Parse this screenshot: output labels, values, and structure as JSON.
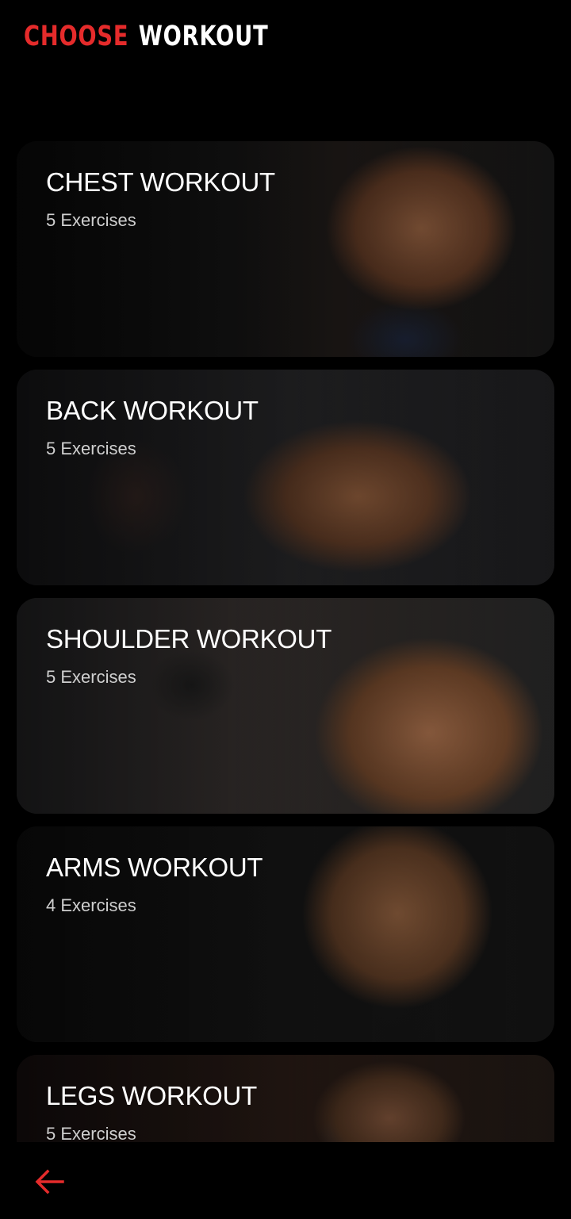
{
  "header": {
    "word1": "CHOOSE",
    "word2": "WORKOUT"
  },
  "workouts": [
    {
      "title": "CHEST WORKOUT",
      "count": "5 Exercises"
    },
    {
      "title": "BACK WORKOUT",
      "count": "5 Exercises"
    },
    {
      "title": "SHOULDER WORKOUT",
      "count": "5 Exercises"
    },
    {
      "title": "ARMS WORKOUT",
      "count": "4 Exercises"
    },
    {
      "title": "LEGS WORKOUT",
      "count": "5 Exercises"
    }
  ],
  "nav": {
    "back_icon": "arrow-left-icon"
  },
  "colors": {
    "accent": "#e52b2b",
    "background": "#000000",
    "text": "#ffffff",
    "subtext": "#cfcfcf"
  }
}
